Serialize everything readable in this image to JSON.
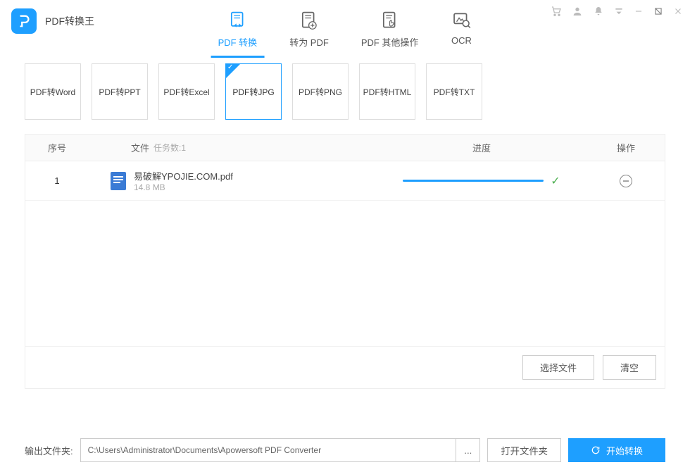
{
  "app": {
    "title": "PDF转换王"
  },
  "nav": {
    "tabs": [
      {
        "label": "PDF 转换",
        "active": true
      },
      {
        "label": "转为 PDF",
        "active": false
      },
      {
        "label": "PDF 其他操作",
        "active": false
      },
      {
        "label": "OCR",
        "active": false
      }
    ]
  },
  "conversion_types": [
    {
      "label": "PDF转Word",
      "active": false
    },
    {
      "label": "PDF转PPT",
      "active": false
    },
    {
      "label": "PDF转Excel",
      "active": false
    },
    {
      "label": "PDF转JPG",
      "active": true
    },
    {
      "label": "PDF转PNG",
      "active": false
    },
    {
      "label": "PDF转HTML",
      "active": false
    },
    {
      "label": "PDF转TXT",
      "active": false
    }
  ],
  "table": {
    "headers": {
      "num": "序号",
      "file": "文件",
      "tasks_label": "任务数:1",
      "progress": "进度",
      "action": "操作"
    },
    "rows": [
      {
        "num": "1",
        "filename": "易破解YPOJIE.COM.pdf",
        "size": "14.8 MB",
        "complete": true
      }
    ],
    "footer": {
      "select_file": "选择文件",
      "clear": "清空"
    }
  },
  "bottom": {
    "output_label": "输出文件夹:",
    "path": "C:\\Users\\Administrator\\Documents\\Apowersoft PDF Converter",
    "browse": "...",
    "open_folder": "打开文件夹",
    "start": "开始转换"
  }
}
